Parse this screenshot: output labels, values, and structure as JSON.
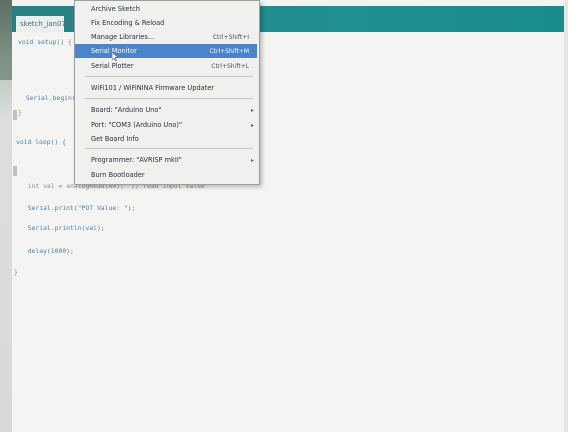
{
  "window": {
    "tab_label": "sketch_jan07a"
  },
  "menu": {
    "items": [
      {
        "label": "Archive Sketch",
        "shortcut": "",
        "submenu": false
      },
      {
        "label": "Fix Encoding & Reload",
        "shortcut": "",
        "submenu": false
      },
      {
        "label": "Manage Libraries...",
        "shortcut": "Ctrl+Shift+I",
        "submenu": false
      },
      {
        "label": "Serial Monitor",
        "shortcut": "Ctrl+Shift+M",
        "submenu": false,
        "highlighted": true
      },
      {
        "label": "Serial Plotter",
        "shortcut": "Ctrl+Shift+L",
        "submenu": false
      },
      {
        "label": "WiFi101 / WiFiNINA Firmware Updater",
        "shortcut": "",
        "submenu": false
      },
      {
        "label": "Board: \"Arduino Uno\"",
        "shortcut": "",
        "submenu": true
      },
      {
        "label": "Port: \"COM3 (Arduino Uno)\"",
        "shortcut": "",
        "submenu": true
      },
      {
        "label": "Get Board Info",
        "shortcut": "",
        "submenu": false
      },
      {
        "label": "Programmer: \"AVRISP mkII\"",
        "shortcut": "",
        "submenu": true
      },
      {
        "label": "Burn Bootloader",
        "shortcut": "",
        "submenu": false
      }
    ]
  },
  "code": {
    "lines": [
      "void setup() {",
      "  Serial.begin(9600);",
      "}",
      "void loop() {",
      "  int val = analogRead(A0);  // read input value",
      "  Serial.print(\"POT Value: \");",
      "  Serial.println(val);",
      "  delay(1000);",
      "}"
    ]
  }
}
